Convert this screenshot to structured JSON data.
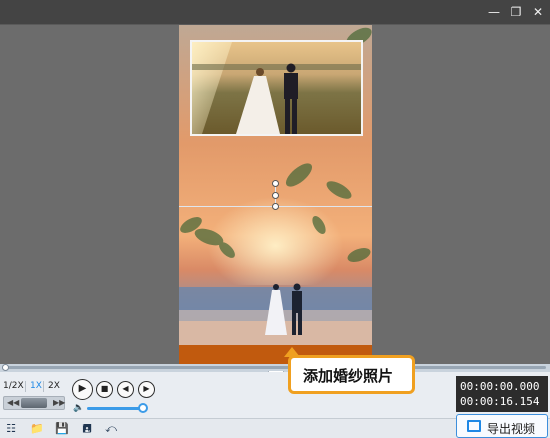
{
  "window": {
    "controls": [
      "minimize-icon",
      "restore-icon",
      "close-icon"
    ]
  },
  "playback": {
    "speed_options": [
      "1/2X",
      "1X",
      "2X"
    ],
    "selected_speed": "1X",
    "volume_level": 0.85,
    "timeline_progress": 0.0
  },
  "time": {
    "current": "00:00:00.000",
    "total": "00:00:16.154"
  },
  "toolbar": {
    "tools": [
      "settings-sliders-icon",
      "open-folder-icon",
      "save-icon",
      "save-as-icon",
      "share-icon"
    ],
    "export_label": "导出视频"
  },
  "tooltip": {
    "text": "添加婚纱照片"
  },
  "colors": {
    "accent": "#1e88e5",
    "tooltip_border": "#f0a020",
    "time_bg": "#2c2c2c"
  }
}
